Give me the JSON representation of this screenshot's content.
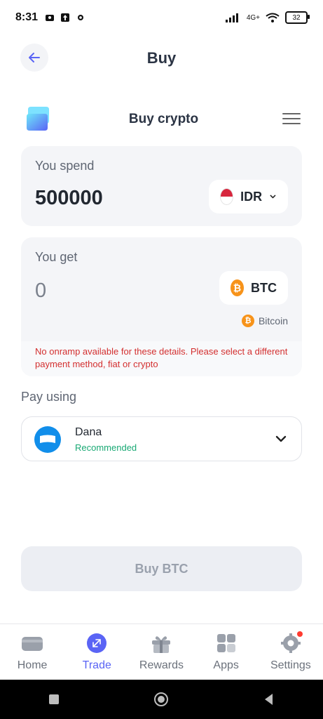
{
  "status_bar": {
    "time": "8:31",
    "battery": "32",
    "network": "4G+"
  },
  "header": {
    "title": "Buy"
  },
  "widget": {
    "title": "Buy crypto"
  },
  "spend": {
    "label": "You spend",
    "amount": "500000",
    "currency": "IDR"
  },
  "get": {
    "label": "You get",
    "amount": "0",
    "token": "BTC",
    "network": "Bitcoin"
  },
  "error": {
    "message": "No onramp available for these details. Please select a different payment method, fiat or crypto"
  },
  "pay": {
    "label": "Pay using",
    "method": "Dana",
    "badge": "Recommended"
  },
  "cta": {
    "label": "Buy BTC"
  },
  "nav": {
    "items": [
      {
        "label": "Home"
      },
      {
        "label": "Trade"
      },
      {
        "label": "Rewards"
      },
      {
        "label": "Apps"
      },
      {
        "label": "Settings"
      }
    ],
    "active_index": 1
  },
  "colors": {
    "accent": "#5A64F5",
    "error": "#D32F2F",
    "success": "#19A974",
    "btc": "#F7931A"
  }
}
